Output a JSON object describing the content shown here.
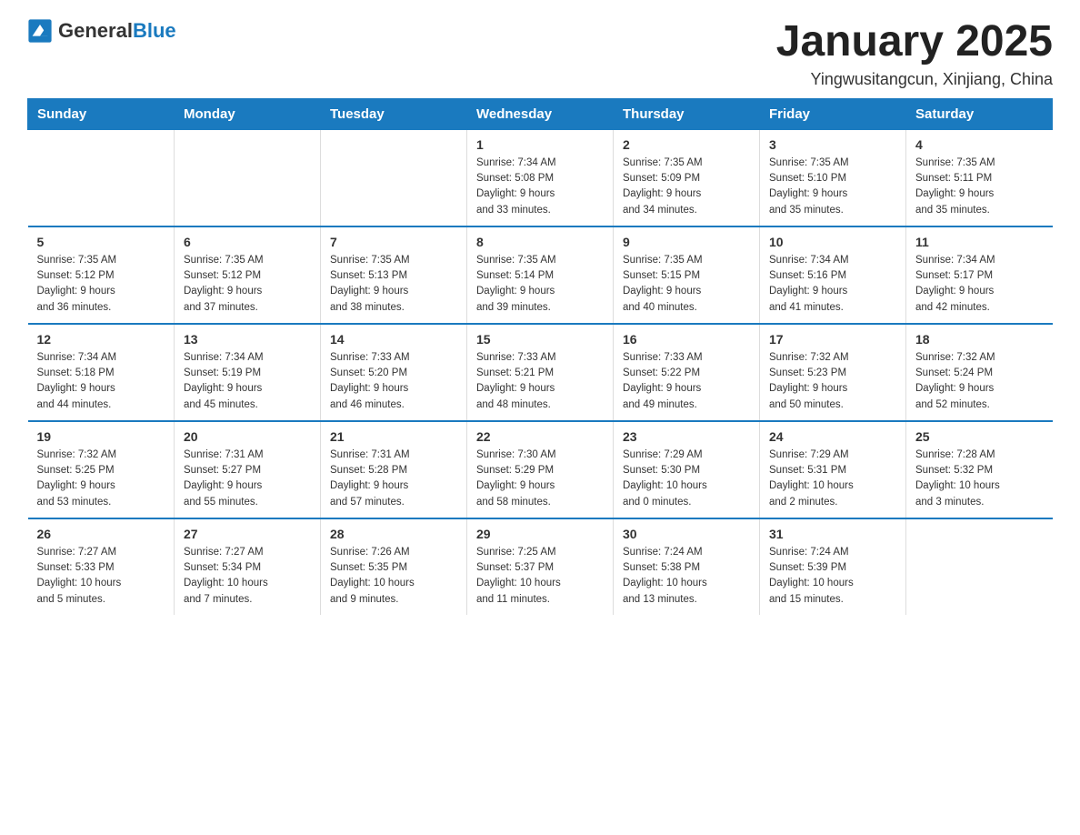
{
  "logo": {
    "text_general": "General",
    "text_blue": "Blue"
  },
  "title": "January 2025",
  "location": "Yingwusitangcun, Xinjiang, China",
  "days_of_week": [
    "Sunday",
    "Monday",
    "Tuesday",
    "Wednesday",
    "Thursday",
    "Friday",
    "Saturday"
  ],
  "weeks": [
    [
      {
        "day": "",
        "info": ""
      },
      {
        "day": "",
        "info": ""
      },
      {
        "day": "",
        "info": ""
      },
      {
        "day": "1",
        "info": "Sunrise: 7:34 AM\nSunset: 5:08 PM\nDaylight: 9 hours\nand 33 minutes."
      },
      {
        "day": "2",
        "info": "Sunrise: 7:35 AM\nSunset: 5:09 PM\nDaylight: 9 hours\nand 34 minutes."
      },
      {
        "day": "3",
        "info": "Sunrise: 7:35 AM\nSunset: 5:10 PM\nDaylight: 9 hours\nand 35 minutes."
      },
      {
        "day": "4",
        "info": "Sunrise: 7:35 AM\nSunset: 5:11 PM\nDaylight: 9 hours\nand 35 minutes."
      }
    ],
    [
      {
        "day": "5",
        "info": "Sunrise: 7:35 AM\nSunset: 5:12 PM\nDaylight: 9 hours\nand 36 minutes."
      },
      {
        "day": "6",
        "info": "Sunrise: 7:35 AM\nSunset: 5:12 PM\nDaylight: 9 hours\nand 37 minutes."
      },
      {
        "day": "7",
        "info": "Sunrise: 7:35 AM\nSunset: 5:13 PM\nDaylight: 9 hours\nand 38 minutes."
      },
      {
        "day": "8",
        "info": "Sunrise: 7:35 AM\nSunset: 5:14 PM\nDaylight: 9 hours\nand 39 minutes."
      },
      {
        "day": "9",
        "info": "Sunrise: 7:35 AM\nSunset: 5:15 PM\nDaylight: 9 hours\nand 40 minutes."
      },
      {
        "day": "10",
        "info": "Sunrise: 7:34 AM\nSunset: 5:16 PM\nDaylight: 9 hours\nand 41 minutes."
      },
      {
        "day": "11",
        "info": "Sunrise: 7:34 AM\nSunset: 5:17 PM\nDaylight: 9 hours\nand 42 minutes."
      }
    ],
    [
      {
        "day": "12",
        "info": "Sunrise: 7:34 AM\nSunset: 5:18 PM\nDaylight: 9 hours\nand 44 minutes."
      },
      {
        "day": "13",
        "info": "Sunrise: 7:34 AM\nSunset: 5:19 PM\nDaylight: 9 hours\nand 45 minutes."
      },
      {
        "day": "14",
        "info": "Sunrise: 7:33 AM\nSunset: 5:20 PM\nDaylight: 9 hours\nand 46 minutes."
      },
      {
        "day": "15",
        "info": "Sunrise: 7:33 AM\nSunset: 5:21 PM\nDaylight: 9 hours\nand 48 minutes."
      },
      {
        "day": "16",
        "info": "Sunrise: 7:33 AM\nSunset: 5:22 PM\nDaylight: 9 hours\nand 49 minutes."
      },
      {
        "day": "17",
        "info": "Sunrise: 7:32 AM\nSunset: 5:23 PM\nDaylight: 9 hours\nand 50 minutes."
      },
      {
        "day": "18",
        "info": "Sunrise: 7:32 AM\nSunset: 5:24 PM\nDaylight: 9 hours\nand 52 minutes."
      }
    ],
    [
      {
        "day": "19",
        "info": "Sunrise: 7:32 AM\nSunset: 5:25 PM\nDaylight: 9 hours\nand 53 minutes."
      },
      {
        "day": "20",
        "info": "Sunrise: 7:31 AM\nSunset: 5:27 PM\nDaylight: 9 hours\nand 55 minutes."
      },
      {
        "day": "21",
        "info": "Sunrise: 7:31 AM\nSunset: 5:28 PM\nDaylight: 9 hours\nand 57 minutes."
      },
      {
        "day": "22",
        "info": "Sunrise: 7:30 AM\nSunset: 5:29 PM\nDaylight: 9 hours\nand 58 minutes."
      },
      {
        "day": "23",
        "info": "Sunrise: 7:29 AM\nSunset: 5:30 PM\nDaylight: 10 hours\nand 0 minutes."
      },
      {
        "day": "24",
        "info": "Sunrise: 7:29 AM\nSunset: 5:31 PM\nDaylight: 10 hours\nand 2 minutes."
      },
      {
        "day": "25",
        "info": "Sunrise: 7:28 AM\nSunset: 5:32 PM\nDaylight: 10 hours\nand 3 minutes."
      }
    ],
    [
      {
        "day": "26",
        "info": "Sunrise: 7:27 AM\nSunset: 5:33 PM\nDaylight: 10 hours\nand 5 minutes."
      },
      {
        "day": "27",
        "info": "Sunrise: 7:27 AM\nSunset: 5:34 PM\nDaylight: 10 hours\nand 7 minutes."
      },
      {
        "day": "28",
        "info": "Sunrise: 7:26 AM\nSunset: 5:35 PM\nDaylight: 10 hours\nand 9 minutes."
      },
      {
        "day": "29",
        "info": "Sunrise: 7:25 AM\nSunset: 5:37 PM\nDaylight: 10 hours\nand 11 minutes."
      },
      {
        "day": "30",
        "info": "Sunrise: 7:24 AM\nSunset: 5:38 PM\nDaylight: 10 hours\nand 13 minutes."
      },
      {
        "day": "31",
        "info": "Sunrise: 7:24 AM\nSunset: 5:39 PM\nDaylight: 10 hours\nand 15 minutes."
      },
      {
        "day": "",
        "info": ""
      }
    ]
  ]
}
